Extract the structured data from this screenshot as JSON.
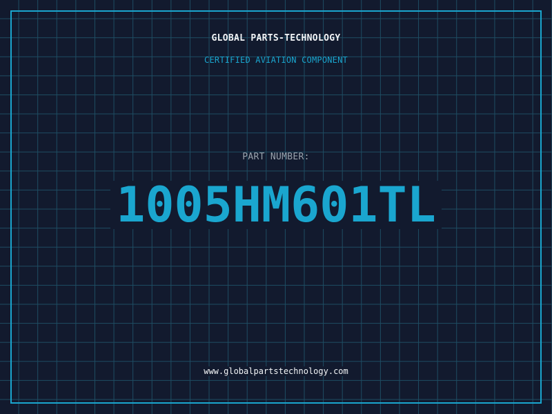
{
  "header": {
    "company": "GLOBAL PARTS-TECHNOLOGY",
    "subtitle": "CERTIFIED AVIATION COMPONENT"
  },
  "part": {
    "label": "PART NUMBER:",
    "number": "1005HM601TL"
  },
  "footer": {
    "website": "www.globalpartstechnology.com"
  },
  "colors": {
    "background": "#121a2e",
    "grid": "#1e4d63",
    "accent": "#1aa6cf",
    "text": "#f2f4f6",
    "muted": "#9aa3ad"
  }
}
